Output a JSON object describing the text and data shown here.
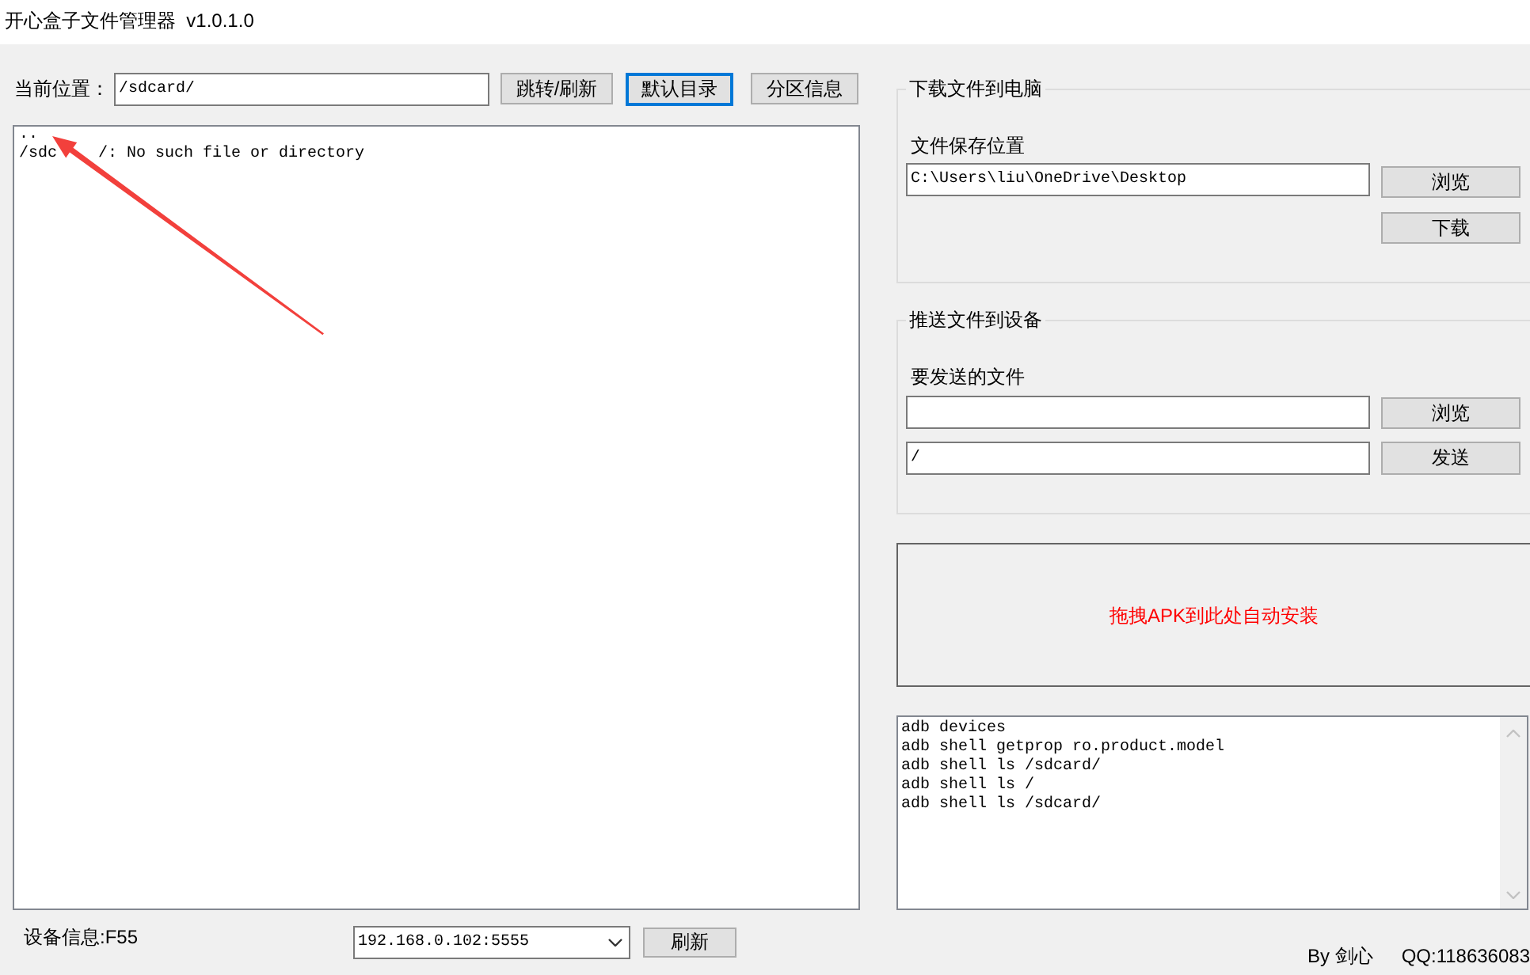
{
  "window": {
    "title": "开心盒子文件管理器  v1.0.1.0"
  },
  "location_bar": {
    "label": "当前位置：",
    "path": "/sdcard/",
    "buttons": [
      {
        "label": "跳转/刷新",
        "focused": false
      },
      {
        "label": "默认目录",
        "focused": true
      },
      {
        "label": "分区信息",
        "focused": false
      }
    ]
  },
  "file_list": {
    "lines": [
      {
        "segments": [
          ".."
        ]
      },
      {
        "segments": [
          "/sdc",
          "/: No such file or directory"
        ]
      }
    ]
  },
  "download_group": {
    "title": "下载文件到电脑",
    "field_label": "文件保存位置",
    "save_path": "C:\\Users\\liu\\OneDrive\\Desktop",
    "browse_button": "浏览",
    "download_button": "下载"
  },
  "push_group": {
    "title": "推送文件到设备",
    "field_label": "要发送的文件",
    "target_path": "/",
    "browse_button": "浏览",
    "send_button": "发送"
  },
  "drop_zone": {
    "text": "拖拽APK到此处自动安装"
  },
  "command_log": {
    "lines": [
      "adb devices",
      "adb shell getprop ro.product.model",
      "adb shell ls /sdcard/",
      "adb shell ls /",
      "adb shell ls /sdcard/"
    ]
  },
  "status_bar": {
    "device_info": "设备信息:F55",
    "device_address": "192.168.0.102:5555",
    "refresh_button": "刷新",
    "author": "By 剑心",
    "qq": "QQ:118636083"
  }
}
